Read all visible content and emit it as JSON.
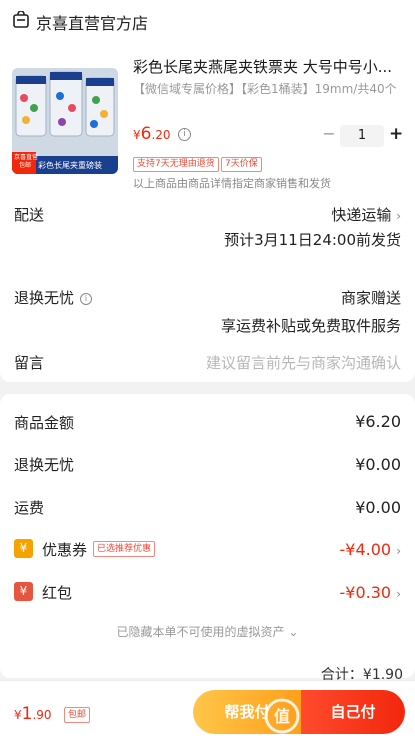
{
  "shop": {
    "name": "京喜直营官方店",
    "icon": "shop-icon"
  },
  "product": {
    "title": "彩色长尾夹燕尾夹铁票夹 大号中号小...",
    "spec": "【微信域专属价格】【彩色1桶装】19mm/共40个",
    "price_symbol": "¥",
    "price_int": "6",
    "price_dec": ".20",
    "quantity": "1",
    "minus": "−",
    "plus": "+",
    "tags": [
      "支持7天无理由退货",
      "7天价保"
    ],
    "note": "以上商品由商品详情指定商家销售和发货",
    "thumb_label": "彩色长尾夹重磅装",
    "thumb_badge": "京喜直营\n包邮"
  },
  "delivery": {
    "label": "配送",
    "value": "快递运输",
    "eta": "预计3月11日24:00前发货"
  },
  "return": {
    "label": "退换无忧",
    "value": "商家赠送",
    "desc": "享运费补贴或免费取件服务"
  },
  "message": {
    "label": "留言",
    "placeholder": "建议留言前先与商家沟通确认"
  },
  "summary": {
    "goods_label": "商品金额",
    "goods_value": "¥6.20",
    "return_label": "退换无忧",
    "return_value": "¥0.00",
    "freight_label": "运费",
    "freight_value": "¥0.00",
    "coupon_label": "优惠券",
    "coupon_tag": "已选推荐优惠",
    "coupon_value": "-¥4.00",
    "coupon_icon_text": "¥",
    "hongbao_label": "红包",
    "hongbao_value": "-¥0.30",
    "hongbao_icon_text": "¥",
    "hidden_note": "已隐藏本单不可使用的虚拟资产",
    "partial": "合计：¥1.90"
  },
  "bottom": {
    "total_symbol": "¥",
    "total_int": "1",
    "total_dec": ".90",
    "free_ship": "包邮",
    "help_pay": "帮我付",
    "pay": "自己付"
  },
  "watermark": "值",
  "colors": {
    "accent": "#f2270c",
    "orange": "#ff9f1a"
  }
}
